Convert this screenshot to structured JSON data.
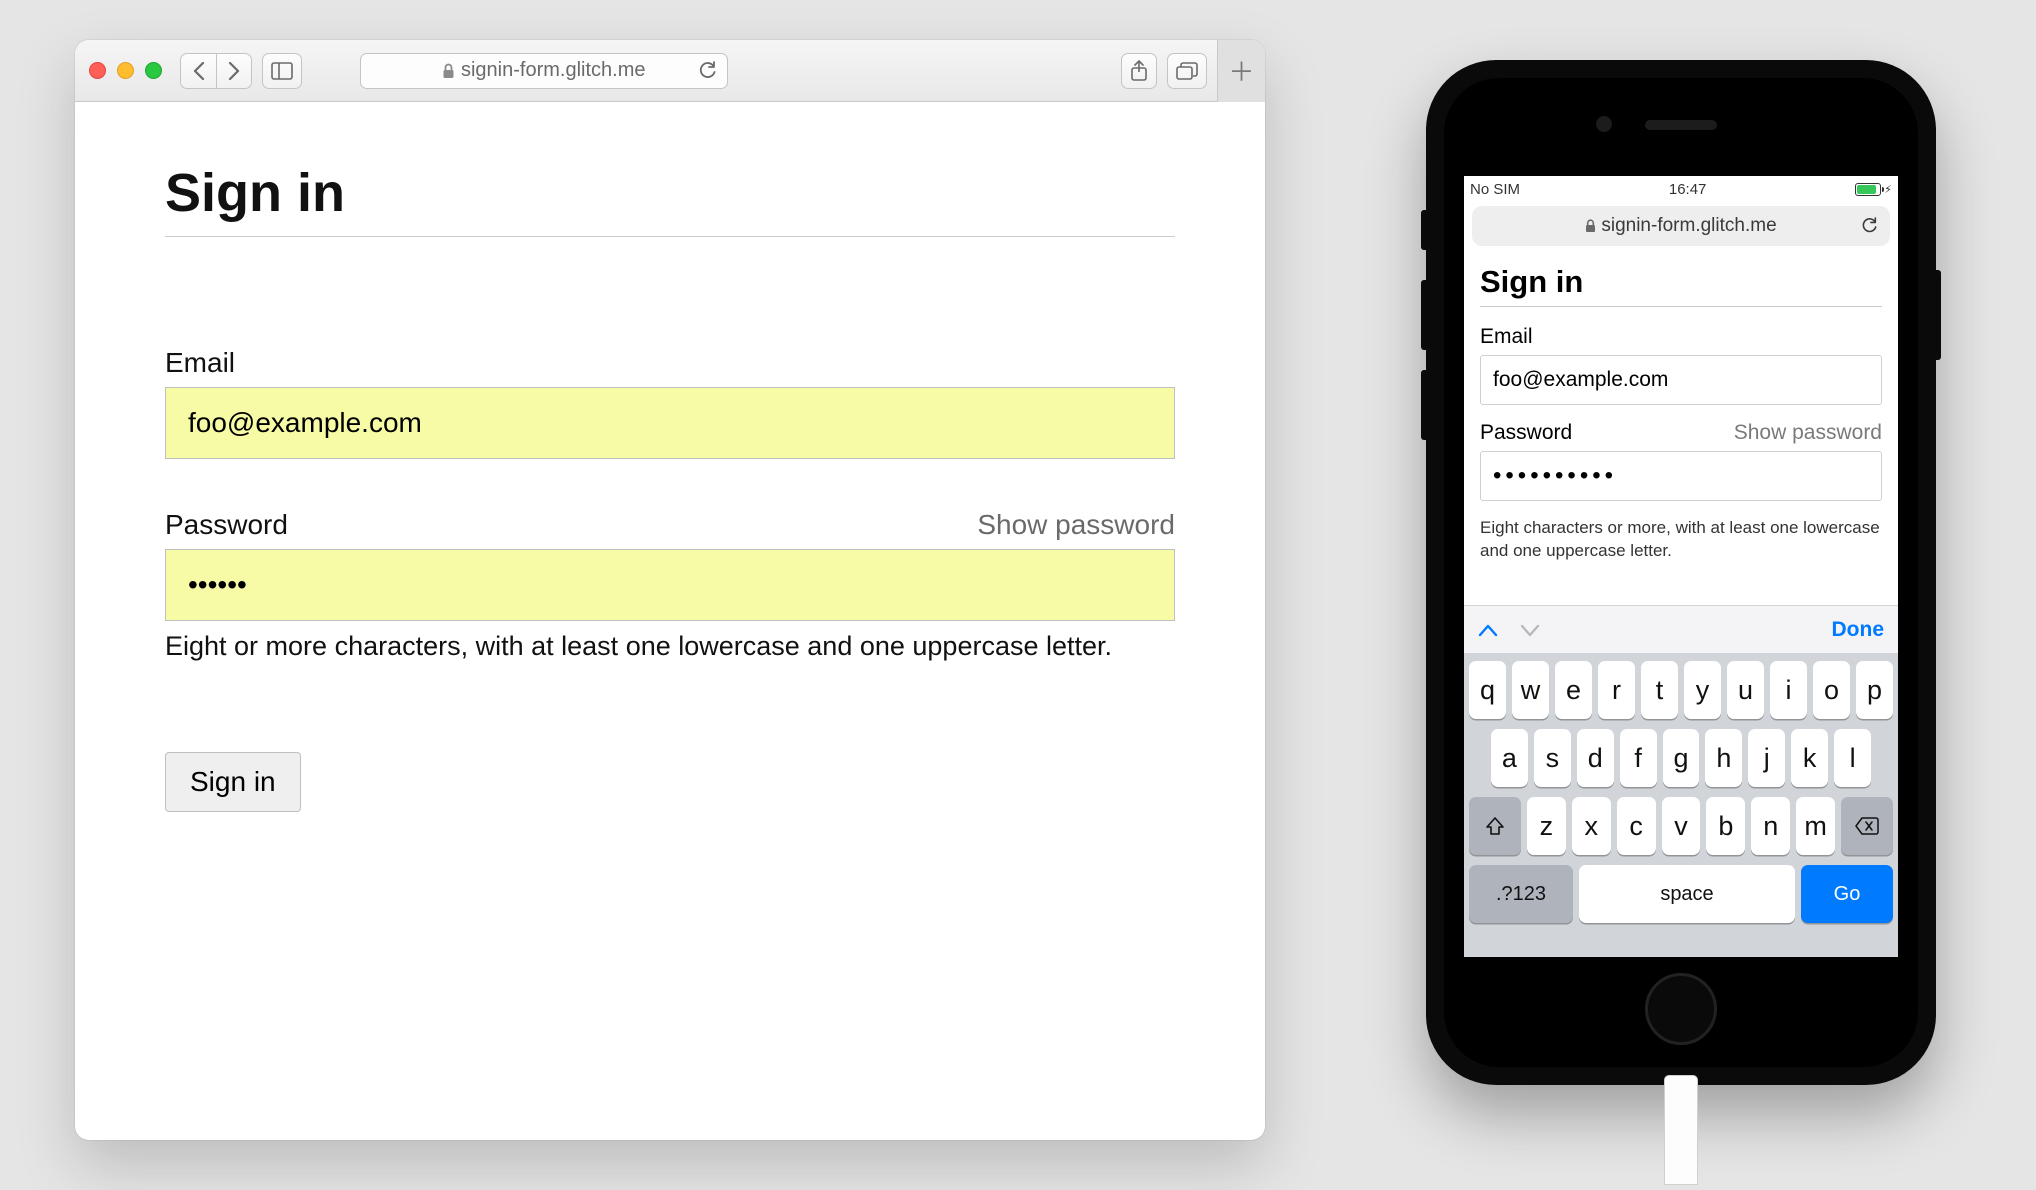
{
  "desktop": {
    "toolbar": {
      "url_host": "signin-form.glitch.me"
    },
    "form": {
      "heading": "Sign in",
      "email_label": "Email",
      "email_value": "foo@example.com",
      "password_label": "Password",
      "show_password": "Show password",
      "password_value": "••••••",
      "hint": "Eight or more characters, with at least one lowercase and one uppercase letter.",
      "submit": "Sign in"
    }
  },
  "mobile": {
    "status": {
      "carrier": "No SIM",
      "time": "16:47"
    },
    "url_host": "signin-form.glitch.me",
    "form": {
      "heading": "Sign in",
      "email_label": "Email",
      "email_value": "foo@example.com",
      "password_label": "Password",
      "show_password": "Show password",
      "password_value": "••••••••••",
      "hint": "Eight characters or more, with at least one lowercase and one uppercase letter."
    },
    "keyboard": {
      "done": "Done",
      "row1": [
        "q",
        "w",
        "e",
        "r",
        "t",
        "y",
        "u",
        "i",
        "o",
        "p"
      ],
      "row2": [
        "a",
        "s",
        "d",
        "f",
        "g",
        "h",
        "j",
        "k",
        "l"
      ],
      "row3": [
        "z",
        "x",
        "c",
        "v",
        "b",
        "n",
        "m"
      ],
      "numkey": ".?123",
      "space": "space",
      "go": "Go"
    }
  }
}
